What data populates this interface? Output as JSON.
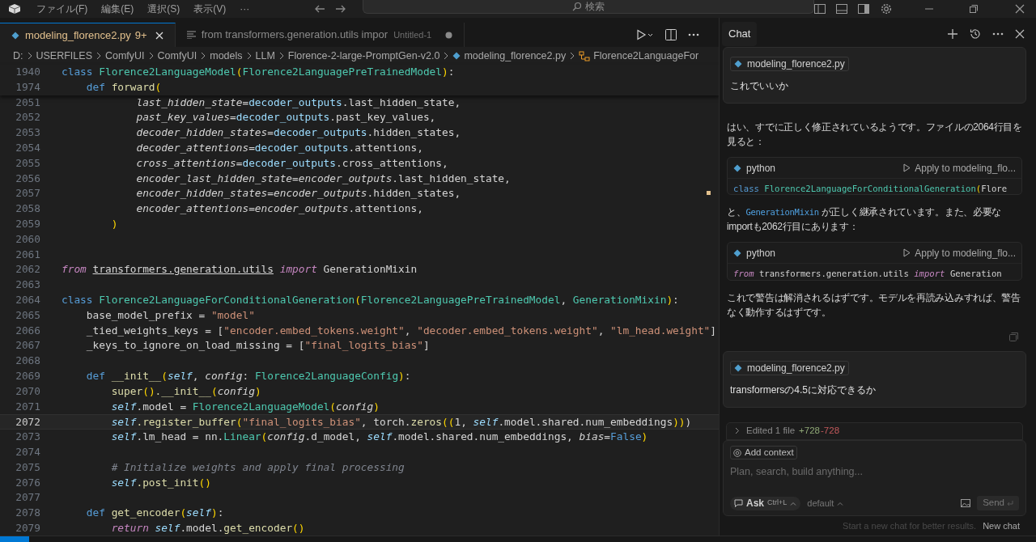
{
  "menu": [
    "ファイル(F)",
    "編集(E)",
    "選択(S)",
    "表示(V)",
    "···"
  ],
  "search": {
    "placeholder": "検索"
  },
  "tabs": [
    {
      "label": "modeling_florence2.py",
      "badge": "9+",
      "kind": "python",
      "selected": true
    },
    {
      "label": "from transformers.generation.utils impor",
      "description": "Untitled-1",
      "kind": "text",
      "selected": false
    }
  ],
  "breadcrumb": [
    {
      "label": "D:",
      "kind": "folder"
    },
    {
      "label": "USERFILES",
      "kind": "folder"
    },
    {
      "label": "ComfyUI",
      "kind": "folder"
    },
    {
      "label": "ComfyUI",
      "kind": "folder"
    },
    {
      "label": "models",
      "kind": "folder"
    },
    {
      "label": "LLM",
      "kind": "folder"
    },
    {
      "label": "Florence-2-large-PromptGen-v2.0",
      "kind": "folder"
    },
    {
      "label": "modeling_florence2.py",
      "kind": "python"
    },
    {
      "label": "Florence2LanguageFor",
      "kind": "class"
    }
  ],
  "editor": {
    "sticky": [
      {
        "num": "1940",
        "tokens": [
          {
            "kind": "kw",
            "text": "class "
          },
          {
            "kind": "cls",
            "text": "Florence2LanguageModel"
          },
          {
            "kind": "paren",
            "text": "("
          },
          {
            "kind": "cls",
            "text": "Florence2LanguagePreTrainedModel"
          },
          {
            "kind": "paren",
            "text": ")"
          },
          {
            "kind": "plain",
            "text": ":"
          }
        ]
      },
      {
        "num": "1974",
        "tokens": [
          {
            "kind": "kw",
            "text": "    def "
          },
          {
            "kind": "fn",
            "text": "forward"
          },
          {
            "kind": "paren",
            "text": "("
          }
        ]
      }
    ],
    "lines": [
      {
        "num": "2051",
        "current": false,
        "tokens": [
          {
            "kind": "param",
            "text": "            last_hidden_state"
          },
          {
            "kind": "plain",
            "text": "="
          },
          {
            "kind": "var",
            "text": "decoder_outputs"
          },
          {
            "kind": "plain",
            "text": ".last_hidden_state,"
          }
        ]
      },
      {
        "num": "2052",
        "current": false,
        "tokens": [
          {
            "kind": "param",
            "text": "            past_key_values"
          },
          {
            "kind": "plain",
            "text": "="
          },
          {
            "kind": "var",
            "text": "decoder_outputs"
          },
          {
            "kind": "plain",
            "text": ".past_key_values,"
          }
        ]
      },
      {
        "num": "2053",
        "current": false,
        "tokens": [
          {
            "kind": "param",
            "text": "            decoder_hidden_states"
          },
          {
            "kind": "plain",
            "text": "="
          },
          {
            "kind": "var",
            "text": "decoder_outputs"
          },
          {
            "kind": "plain",
            "text": ".hidden_states,"
          }
        ]
      },
      {
        "num": "2054",
        "current": false,
        "tokens": [
          {
            "kind": "param",
            "text": "            decoder_attentions"
          },
          {
            "kind": "plain",
            "text": "="
          },
          {
            "kind": "var",
            "text": "decoder_outputs"
          },
          {
            "kind": "plain",
            "text": ".attentions,"
          }
        ]
      },
      {
        "num": "2055",
        "current": false,
        "tokens": [
          {
            "kind": "param",
            "text": "            cross_attentions"
          },
          {
            "kind": "plain",
            "text": "="
          },
          {
            "kind": "var",
            "text": "decoder_outputs"
          },
          {
            "kind": "plain",
            "text": ".cross_attentions,"
          }
        ]
      },
      {
        "num": "2056",
        "current": false,
        "tokens": [
          {
            "kind": "param",
            "text": "            encoder_last_hidden_state"
          },
          {
            "kind": "plain",
            "text": "="
          },
          {
            "kind": "param",
            "text": "encoder_outputs"
          },
          {
            "kind": "plain",
            "text": ".last_hidden_state,"
          }
        ]
      },
      {
        "num": "2057",
        "current": false,
        "tokens": [
          {
            "kind": "param",
            "text": "            encoder_hidden_states"
          },
          {
            "kind": "plain",
            "text": "="
          },
          {
            "kind": "param",
            "text": "encoder_outputs"
          },
          {
            "kind": "plain",
            "text": ".hidden_states,"
          }
        ]
      },
      {
        "num": "2058",
        "current": false,
        "tokens": [
          {
            "kind": "param",
            "text": "            encoder_attentions"
          },
          {
            "kind": "plain",
            "text": "="
          },
          {
            "kind": "param",
            "text": "encoder_outputs"
          },
          {
            "kind": "plain",
            "text": ".attentions,"
          }
        ]
      },
      {
        "num": "2059",
        "current": false,
        "tokens": [
          {
            "kind": "paren",
            "text": "        )"
          }
        ]
      },
      {
        "num": "2060",
        "current": false
      },
      {
        "num": "2061",
        "current": false
      },
      {
        "num": "2062",
        "current": false,
        "tokens": [
          {
            "kind": "kwi",
            "text": "from "
          },
          {
            "kind": "mod",
            "text": "transformers.generation.utils"
          },
          {
            "kind": "kwi",
            "text": " import "
          },
          {
            "kind": "plain",
            "text": "GenerationMixin"
          }
        ]
      },
      {
        "num": "2063",
        "current": false
      },
      {
        "num": "2064",
        "current": false,
        "tokens": [
          {
            "kind": "kw",
            "text": "class "
          },
          {
            "kind": "cls",
            "text": "Florence2LanguageForConditionalGeneration"
          },
          {
            "kind": "paren",
            "text": "("
          },
          {
            "kind": "cls",
            "text": "Florence2LanguagePreTrainedModel"
          },
          {
            "kind": "plain",
            "text": ", "
          },
          {
            "kind": "cls",
            "text": "GenerationMixin"
          },
          {
            "kind": "paren",
            "text": ")"
          },
          {
            "kind": "plain",
            "text": ":"
          }
        ]
      },
      {
        "num": "2065",
        "current": false,
        "tokens": [
          {
            "kind": "plain",
            "text": "    base_model_prefix = "
          },
          {
            "kind": "str",
            "text": "\"model\""
          }
        ]
      },
      {
        "num": "2066",
        "current": false,
        "tokens": [
          {
            "kind": "plain",
            "text": "    _tied_weights_keys = ["
          },
          {
            "kind": "str",
            "text": "\"encoder.embed_tokens.weight\""
          },
          {
            "kind": "plain",
            "text": ", "
          },
          {
            "kind": "str",
            "text": "\"decoder.embed_tokens.weight\""
          },
          {
            "kind": "plain",
            "text": ", "
          },
          {
            "kind": "str",
            "text": "\"lm_head.weight\""
          },
          {
            "kind": "plain",
            "text": "]"
          }
        ]
      },
      {
        "num": "2067",
        "current": false,
        "tokens": [
          {
            "kind": "plain",
            "text": "    _keys_to_ignore_on_load_missing = ["
          },
          {
            "kind": "str",
            "text": "\"final_logits_bias\""
          },
          {
            "kind": "plain",
            "text": "]"
          }
        ]
      },
      {
        "num": "2068",
        "current": false
      },
      {
        "num": "2069",
        "current": false,
        "tokens": [
          {
            "kind": "kw",
            "text": "    def "
          },
          {
            "kind": "fn",
            "text": "__init__"
          },
          {
            "kind": "paren",
            "text": "("
          },
          {
            "kind": "self",
            "text": "self"
          },
          {
            "kind": "plain",
            "text": ", "
          },
          {
            "kind": "param",
            "text": "config"
          },
          {
            "kind": "plain",
            "text": ": "
          },
          {
            "kind": "cls",
            "text": "Florence2LanguageConfig"
          },
          {
            "kind": "paren",
            "text": ")"
          },
          {
            "kind": "plain",
            "text": ":"
          }
        ]
      },
      {
        "num": "2070",
        "current": false,
        "tokens": [
          {
            "kind": "fn",
            "text": "        super"
          },
          {
            "kind": "paren",
            "text": "()"
          },
          {
            "kind": "fn",
            "text": ".__init__"
          },
          {
            "kind": "paren",
            "text": "("
          },
          {
            "kind": "param",
            "text": "config"
          },
          {
            "kind": "paren",
            "text": ")"
          }
        ]
      },
      {
        "num": "2071",
        "current": false,
        "tokens": [
          {
            "kind": "self",
            "text": "        self"
          },
          {
            "kind": "plain",
            "text": ".model = "
          },
          {
            "kind": "cls",
            "text": "Florence2LanguageModel"
          },
          {
            "kind": "paren",
            "text": "("
          },
          {
            "kind": "param",
            "text": "config"
          },
          {
            "kind": "paren",
            "text": ")"
          }
        ]
      },
      {
        "num": "2072",
        "current": true,
        "tokens": [
          {
            "kind": "self",
            "text": "        self"
          },
          {
            "kind": "fn",
            "text": ".register_buffer"
          },
          {
            "kind": "paren",
            "text": "("
          },
          {
            "kind": "str",
            "text": "\"final_logits_bias\""
          },
          {
            "kind": "plain",
            "text": ", torch."
          },
          {
            "kind": "fn",
            "text": "zeros"
          },
          {
            "kind": "paren",
            "text": "(("
          },
          {
            "kind": "plain",
            "text": "1, "
          },
          {
            "kind": "self",
            "text": "self"
          },
          {
            "kind": "plain",
            "text": ".model.shared.num_embeddings"
          },
          {
            "kind": "paren",
            "text": "))"
          },
          {
            "kind": "plain",
            "text": ")"
          }
        ]
      },
      {
        "num": "2073",
        "current": false,
        "tokens": [
          {
            "kind": "self",
            "text": "        self"
          },
          {
            "kind": "plain",
            "text": ".lm_head = nn."
          },
          {
            "kind": "cls",
            "text": "Linear"
          },
          {
            "kind": "paren",
            "text": "("
          },
          {
            "kind": "param",
            "text": "config"
          },
          {
            "kind": "plain",
            "text": ".d_model, "
          },
          {
            "kind": "self",
            "text": "self"
          },
          {
            "kind": "plain",
            "text": ".model.shared.num_embeddings, "
          },
          {
            "kind": "param",
            "text": "bias"
          },
          {
            "kind": "plain",
            "text": "="
          },
          {
            "kind": "kw",
            "text": "False"
          },
          {
            "kind": "paren",
            "text": ")"
          }
        ]
      },
      {
        "num": "2074",
        "current": false
      },
      {
        "num": "2075",
        "current": false,
        "tokens": [
          {
            "kind": "cmt",
            "text": "        # Initialize weights and apply final processing"
          }
        ]
      },
      {
        "num": "2076",
        "current": false,
        "tokens": [
          {
            "kind": "self",
            "text": "        self"
          },
          {
            "kind": "fn",
            "text": ".post_init"
          },
          {
            "kind": "paren",
            "text": "()"
          }
        ]
      },
      {
        "num": "2077",
        "current": false
      },
      {
        "num": "2078",
        "current": false,
        "tokens": [
          {
            "kind": "kw",
            "text": "    def "
          },
          {
            "kind": "fn",
            "text": "get_encoder"
          },
          {
            "kind": "paren",
            "text": "("
          },
          {
            "kind": "self",
            "text": "self"
          },
          {
            "kind": "paren",
            "text": ")"
          },
          {
            "kind": "plain",
            "text": ":"
          }
        ]
      },
      {
        "num": "2079",
        "current": false,
        "tokens": [
          {
            "kind": "kwi",
            "text": "        return "
          },
          {
            "kind": "self",
            "text": "self"
          },
          {
            "kind": "plain",
            "text": ".model."
          },
          {
            "kind": "fn",
            "text": "get_encoder"
          },
          {
            "kind": "paren",
            "text": "()"
          }
        ]
      }
    ]
  },
  "chat": {
    "title": "Chat",
    "messages": [
      {
        "kind": "user",
        "file": "modeling_florence2.py",
        "text": "これでいいか"
      },
      {
        "kind": "paragraph",
        "parts": [
          {
            "kind": "text",
            "text": "はい、すでに正しく修正されているようです。ファイルの2064行目を見ると："
          }
        ]
      },
      {
        "kind": "code",
        "lang": "python",
        "apply": "Apply to modeling_flo...",
        "tokens": [
          {
            "kind": "kw",
            "text": "class "
          },
          {
            "kind": "cls",
            "text": "Florence2LanguageForConditionalGeneration"
          },
          {
            "kind": "paren",
            "text": "("
          },
          {
            "kind": "plain",
            "text": "Flore"
          }
        ]
      },
      {
        "kind": "paragraph",
        "parts": [
          {
            "kind": "text",
            "text": "と、"
          },
          {
            "kind": "code",
            "text": "GenerationMixin"
          },
          {
            "kind": "text",
            "text": " が正しく継承されています。また、必要なimportも2062行目にあります："
          }
        ]
      },
      {
        "kind": "code",
        "lang": "python",
        "apply": "Apply to modeling_flo...",
        "tokens": [
          {
            "kind": "kwi",
            "text": "from "
          },
          {
            "kind": "plain",
            "text": "transformers.generation.utils "
          },
          {
            "kind": "kwi",
            "text": "import "
          },
          {
            "kind": "plain",
            "text": "Generation"
          }
        ]
      },
      {
        "kind": "paragraph",
        "parts": [
          {
            "kind": "text",
            "text": "これで警告は解消されるはずです。モデルを再読み込みすれば、警告なく動作するはずです。"
          }
        ]
      },
      {
        "kind": "copy"
      },
      {
        "kind": "user",
        "file": "modeling_florence2.py",
        "text": "transformersの4.5に対応できるか"
      },
      {
        "kind": "edit",
        "label": "Edited 1 file",
        "added": "+728",
        "removed": "-728"
      }
    ],
    "input": {
      "context": "Add context",
      "placeholder": "Plan, search, build anything...",
      "mode": "Ask",
      "shortcut": "Ctrl+L",
      "model": "default",
      "send": "Send"
    },
    "hint": "Start a new chat for better results.",
    "new_chat": "New chat"
  }
}
